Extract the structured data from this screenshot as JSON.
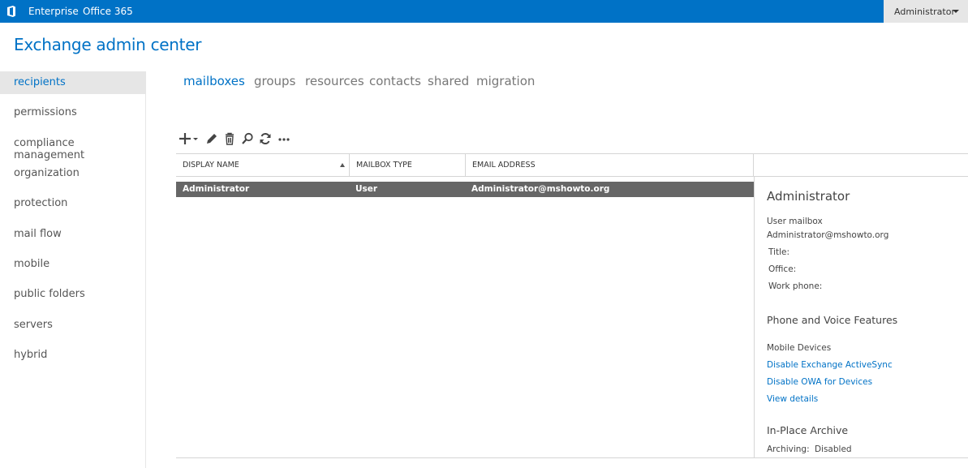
{
  "topbar": {
    "brand_icon": "office-logo-icon",
    "links": [
      "Enterprise",
      "Office 365"
    ],
    "user": "Administrator",
    "accent": "#0072c6"
  },
  "app_title": "Exchange admin center",
  "leftnav": {
    "items": [
      "recipients",
      "permissions",
      "compliance management",
      "organization",
      "protection",
      "mail flow",
      "mobile",
      "public folders",
      "servers",
      "hybrid"
    ],
    "active": "recipients"
  },
  "tabs": {
    "items": [
      "mailboxes",
      "groups",
      "resources",
      "contacts",
      "shared",
      "migration"
    ],
    "active": "mailboxes"
  },
  "toolbar": {
    "icons": [
      "add-icon",
      "edit-icon",
      "delete-icon",
      "search-icon",
      "refresh-icon",
      "more-icon"
    ]
  },
  "grid": {
    "columns": [
      "DISPLAY NAME",
      "MAILBOX TYPE",
      "EMAIL ADDRESS"
    ],
    "sort_column": "DISPLAY NAME",
    "rows": [
      {
        "display_name": "Administrator",
        "mailbox_type": "User",
        "email": "Administrator@mshowto.org",
        "selected": true
      }
    ]
  },
  "details": {
    "name": "Administrator",
    "type": "User mailbox",
    "email": "Administrator@mshowto.org",
    "title_label": "Title:",
    "office_label": "Office:",
    "phone_label": "Work phone:",
    "phone_section": "Phone and Voice Features",
    "mobile_devices": "Mobile Devices",
    "link_activesync": "Disable Exchange ActiveSync",
    "link_owa": "Disable OWA for Devices",
    "link_view": "View details",
    "archive_section": "In-Place Archive",
    "archiving_label": "Archiving:",
    "archiving_value": "Disabled"
  }
}
